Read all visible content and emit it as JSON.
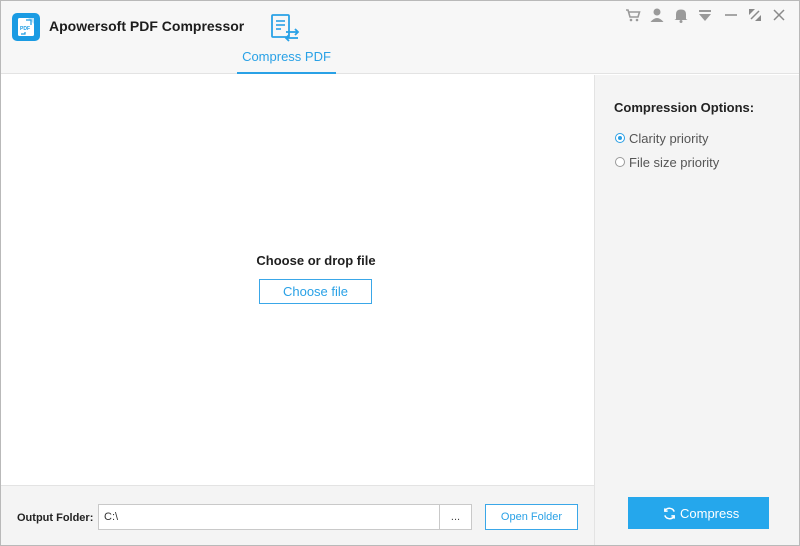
{
  "app": {
    "title": "Apowersoft PDF Compressor",
    "logo_text": "PDF",
    "accent_color": "#29a1e6"
  },
  "tabs": [
    {
      "label": "Compress PDF",
      "icon": "document-swap-icon",
      "active": true
    }
  ],
  "window_controls": [
    {
      "name": "cart-icon"
    },
    {
      "name": "user-icon"
    },
    {
      "name": "bell-icon"
    },
    {
      "name": "dropdown-menu-icon"
    },
    {
      "name": "minimize-icon"
    },
    {
      "name": "restore-icon"
    },
    {
      "name": "close-icon"
    }
  ],
  "main": {
    "drop_title": "Choose or drop file",
    "choose_button": "Choose file"
  },
  "side": {
    "title": "Compression Options:",
    "options": [
      {
        "label": "Clarity priority",
        "checked": true
      },
      {
        "label": "File size priority",
        "checked": false
      }
    ],
    "compress_button": "Compress"
  },
  "bottom": {
    "output_label": "Output Folder:",
    "output_value": "C:\\",
    "browse_button": "...",
    "open_button": "Open Folder"
  }
}
